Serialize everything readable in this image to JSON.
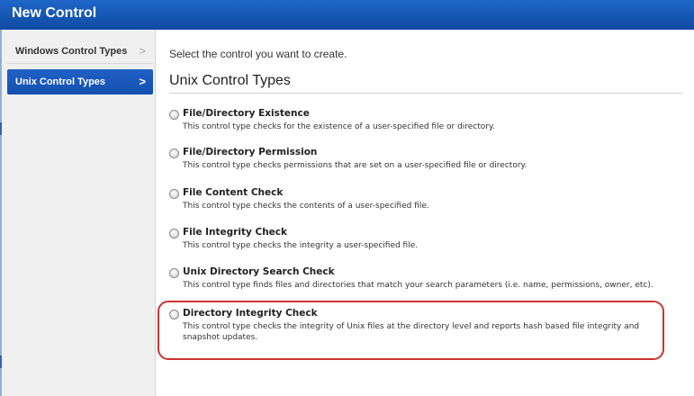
{
  "window": {
    "title": "New Control"
  },
  "sidebar": {
    "items": [
      {
        "label": "Windows Control Types",
        "chevron": ">"
      },
      {
        "label": "Unix Control Types",
        "chevron": ">"
      }
    ]
  },
  "main": {
    "instruction": "Select the control you want to create.",
    "section_title": "Unix Control Types",
    "options": [
      {
        "title": "File/Directory Existence",
        "description": "This control type checks for the existence of a user-specified file or directory."
      },
      {
        "title": "File/Directory Permission",
        "description": "This control type checks permissions that are set on a user-specified file or directory."
      },
      {
        "title": "File Content Check",
        "description": "This control type checks the contents of a user-specified file."
      },
      {
        "title": "File Integrity Check",
        "description": "This control type checks the integrity a user-specified file."
      },
      {
        "title": "Unix Directory Search Check",
        "description": "This control type finds files and directories that match your search parameters (i.e. name, permissions, owner, etc)."
      },
      {
        "title": "Directory Integrity Check",
        "description": "This control type checks the integrity of Unix files at the directory level and reports hash based file integrity and snapshot updates."
      }
    ]
  },
  "colors": {
    "titlebar": "#1856b8",
    "selected_item": "#1a58bb",
    "highlight_ring": "#cc3333"
  }
}
